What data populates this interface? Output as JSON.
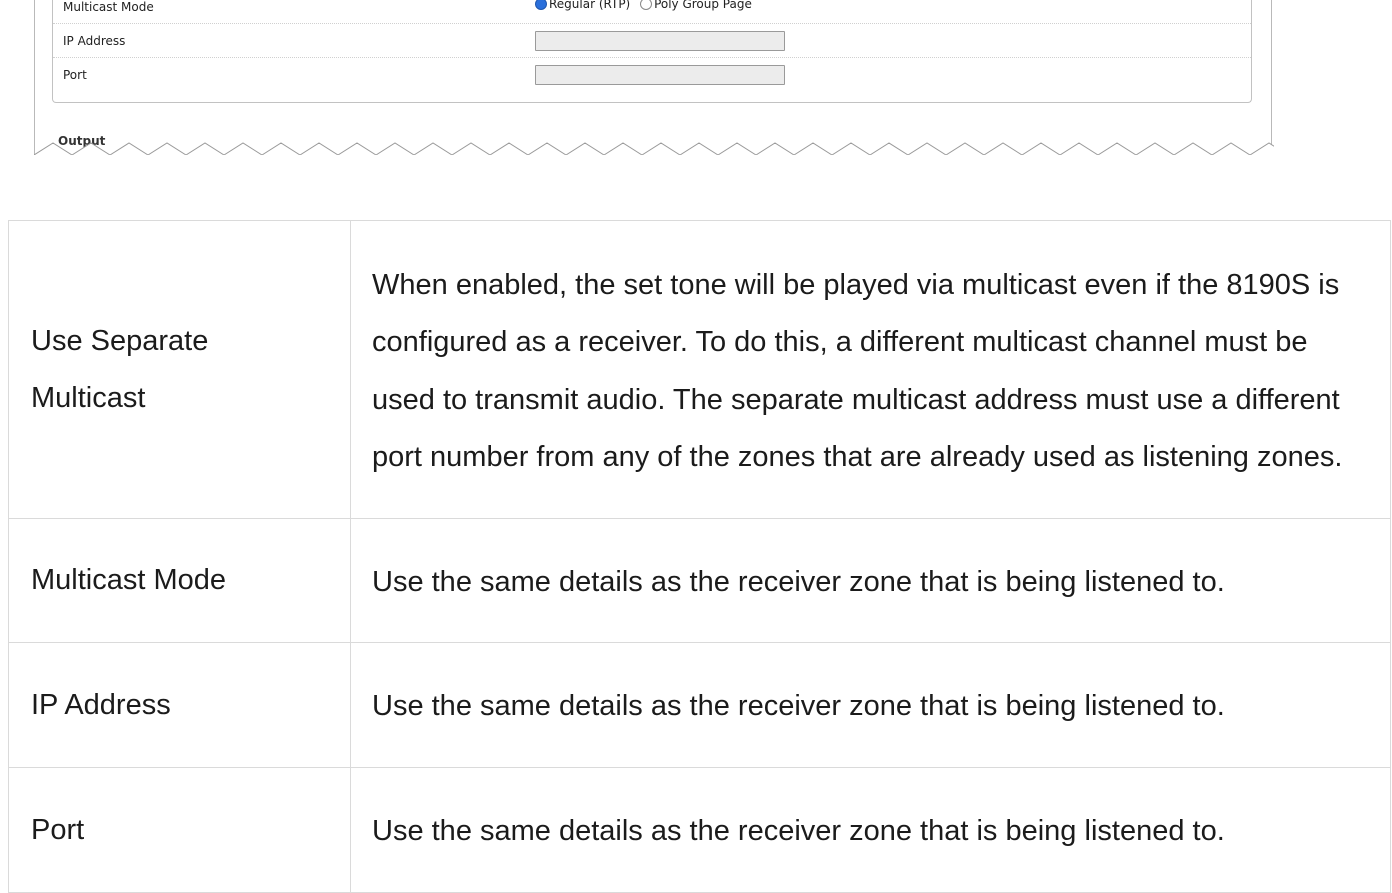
{
  "screenshot": {
    "rows": [
      {
        "label": "Multicast Mode",
        "type": "radio",
        "options": [
          "Regular (RTP)",
          "Poly Group Page"
        ],
        "selected": "Regular (RTP)"
      },
      {
        "label": "IP Address",
        "type": "text",
        "value": ""
      },
      {
        "label": "Port",
        "type": "text",
        "value": ""
      }
    ],
    "output_legend": "Output"
  },
  "table": {
    "rows": [
      {
        "term": "Use Separate Multicast",
        "description": "When enabled, the set tone will be played via multicast even if the 8190S is configured as a receiver. To do this, a different multicast channel must be used to transmit audio. The separate multicast address must use a different port number from any of the zones that are already used as listening zones."
      },
      {
        "term": "Multicast Mode",
        "description": "Use the same details as the receiver zone that is being listened to."
      },
      {
        "term": "IP Address",
        "description": "Use the same details as the receiver zone that is being listened to."
      },
      {
        "term": "Port",
        "description": "Use the same details as the receiver zone that is being listened to."
      }
    ]
  }
}
